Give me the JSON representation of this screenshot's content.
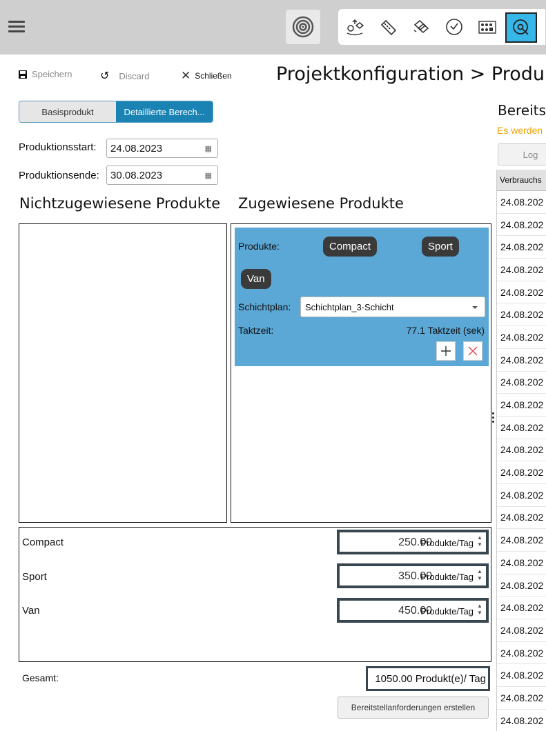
{
  "toolbar": {
    "save_label": "Speichern",
    "discard_label": "Discard",
    "close_label": "Schließen",
    "tools": [
      "shapes-move-icon",
      "edit-ruler-icon",
      "layers-icon",
      "clock-icon",
      "grid-matrix-icon",
      "zoom-target-icon"
    ],
    "active_tool": "zoom-target-icon"
  },
  "page_title": "Projektkonfiguration > Produk",
  "mode_tabs": {
    "basis": "Basisprodukt",
    "detail": "Detaillierte Berech...",
    "selected": "detail"
  },
  "production": {
    "start_label": "Produktionsstart:",
    "start_value": "24.08.2023",
    "end_label": "Produktionsende:",
    "end_value": "30.08.2023"
  },
  "unassigned_title": "Nichtzugewiesene Produkte",
  "assigned_title": "Zugewiesene Produkte",
  "assigned_card": {
    "products_label": "Produkte:",
    "chips": [
      "Compact",
      "Sport",
      "Van"
    ],
    "shift_label": "Schichtplan:",
    "shift_value": "Schichtplan_3-Schicht",
    "cycle_label": "Taktzeit:",
    "cycle_value": "77.1 Taktzeit (sek)"
  },
  "quantities": [
    {
      "name": "Compact",
      "value": "250.00",
      "unit": "Produkte/Tag"
    },
    {
      "name": "Sport",
      "value": "350.00",
      "unit": "Produkte/Tag"
    },
    {
      "name": "Van",
      "value": "450.00",
      "unit": "Produkte/Tag"
    }
  ],
  "total": {
    "label": "Gesamt:",
    "value": "1050.00 Produkt(e)/ Tag"
  },
  "create_button": "Bereitstellanforderungen erstellen",
  "right_panel": {
    "title": "Bereits",
    "subtitle": "Es werden",
    "log_button": "Log",
    "column_header": "Verbrauchs",
    "rows": [
      "24.08.202",
      "24.08.202",
      "24.08.202",
      "24.08.202",
      "24.08.202",
      "24.08.202",
      "24.08.202",
      "24.08.202",
      "24.08.202",
      "24.08.202",
      "24.08.202",
      "24.08.202",
      "24.08.202",
      "24.08.202",
      "24.08.202",
      "24.08.202",
      "24.08.202",
      "24.08.202",
      "24.08.202",
      "24.08.202",
      "24.08.202",
      "24.08.202",
      "24.08.202",
      "24.08.202"
    ]
  }
}
